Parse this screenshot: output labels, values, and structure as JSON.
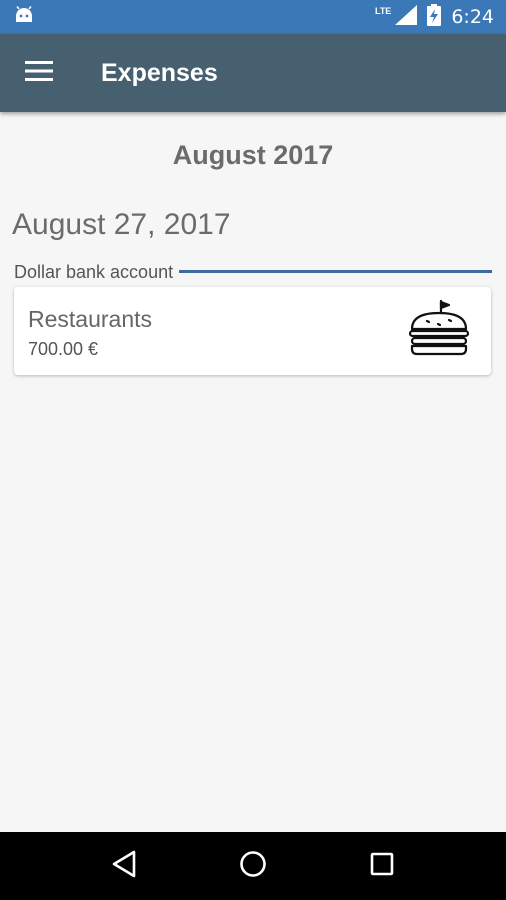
{
  "status_bar": {
    "time": "6:24",
    "network": "LTE",
    "icons": [
      "android-icon",
      "lte-signal-icon",
      "battery-charging-icon"
    ]
  },
  "app_bar": {
    "title": "Expenses",
    "menu_icon": "hamburger-menu-icon"
  },
  "content": {
    "month_header": "August 2017",
    "groups": [
      {
        "date": "August 27, 2017",
        "account": "Dollar bank account",
        "account_color": "#3d6aa0",
        "expenses": [
          {
            "category": "Restaurants",
            "amount": "700.00 €",
            "icon": "burger-icon"
          }
        ]
      }
    ]
  },
  "nav_bar": {
    "buttons": [
      "back-icon",
      "home-icon",
      "recents-icon"
    ]
  },
  "colors": {
    "status_bar": "#3b78b8",
    "app_bar": "#47606f",
    "background": "#f6f6f6",
    "nav_bar": "#000000"
  }
}
